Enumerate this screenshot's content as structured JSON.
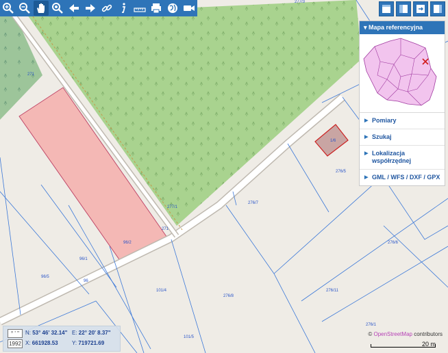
{
  "toolbar": {
    "tools": [
      {
        "name": "zoom-in-icon"
      },
      {
        "name": "zoom-out-icon"
      },
      {
        "name": "pan-hand-icon"
      },
      {
        "name": "zoom-extent-icon"
      },
      {
        "name": "back-arrow-icon"
      },
      {
        "name": "forward-arrow-icon"
      },
      {
        "name": "link-icon"
      },
      {
        "name": "info-icon"
      },
      {
        "name": "measure-ruler-icon"
      },
      {
        "name": "print-icon"
      },
      {
        "name": "globe-icon"
      },
      {
        "name": "video-camera-icon"
      }
    ],
    "color": "#2e74b8"
  },
  "side_panel": {
    "header": "Mapa referencyjna",
    "items": [
      "Pomiary",
      "Szukaj",
      "Lokalizacja współrzędnej",
      "GML / WFS / DXF / GPX"
    ]
  },
  "parcels": {
    "labels": [
      "277/3",
      "277/1",
      "271",
      "271",
      "96/2",
      "96/1",
      "96/5",
      "96",
      "276/7",
      "276/5",
      "276/6",
      "276/11",
      "101/4",
      "276/8",
      "101/5",
      "276/1",
      "1/6"
    ]
  },
  "coordinates": {
    "system_icon": "° ' \"",
    "system": "1992",
    "n_label": "N:",
    "n_value": "53° 46' 32.14\"",
    "e_label": "E:",
    "e_value": "22° 20' 8.37\"",
    "x_label": "X:",
    "x_value": "661928.53",
    "y_label": "Y:",
    "y_value": "719721.69"
  },
  "attribution": {
    "prefix": "©",
    "link": "OpenStreetMap",
    "suffix": " contributors"
  },
  "scale": {
    "label": "20 m"
  },
  "colors": {
    "forest": "#a8d08d",
    "forest_dark": "#8fbf80",
    "highlight": "#f4b8b5",
    "parcel_line": "#3b78d8",
    "selected": "#cc2222"
  }
}
